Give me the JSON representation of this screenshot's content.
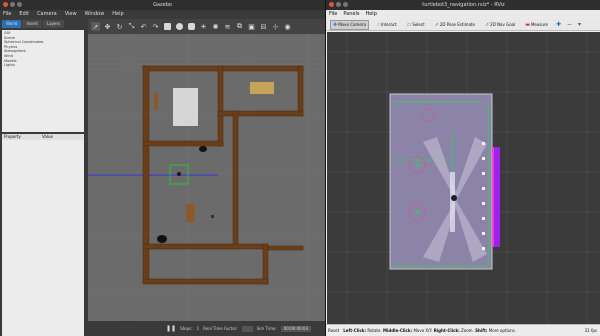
{
  "gazebo": {
    "title": "Gazebo",
    "menu": [
      "File",
      "Edit",
      "Camera",
      "View",
      "Window",
      "Help"
    ],
    "tabs": [
      "World",
      "Insert",
      "Layers"
    ],
    "world_tree": [
      "GUI",
      "Scene",
      "Spherical Coordinates",
      "Physics",
      "Atmosphere",
      "Wind",
      "Models",
      "Lights"
    ],
    "prop_headers": [
      "Property",
      "Value"
    ],
    "bottom": {
      "steps_label": "Steps:",
      "steps_value": "1",
      "rtf_label": "Real Time Factor:",
      "time_label": "Sim Time:",
      "time_value": "00:00:00:03"
    }
  },
  "rviz": {
    "title": "turtlebot3_navigation.rviz* - RViz",
    "menu": [
      "File",
      "Panels",
      "Help"
    ],
    "tools": [
      "Move Camera",
      "Interact",
      "Select",
      "2D Pose Estimate",
      "2D Nav Goal",
      "Measure"
    ],
    "status": {
      "reset": "Reset",
      "l": "Left-Click:",
      "l_text": "Rotate.",
      "m": "Middle-Click:",
      "m_text": "Move X/Y.",
      "r": "Right-Click:",
      "r_text": "Zoom.",
      "s": "Shift:",
      "s_text": "More options.",
      "fps": "31 fps"
    }
  },
  "colors": {
    "wall": "#6b3e18",
    "floor": "#6b6b6b",
    "map_free": "#8c83a8",
    "costmap": "#a020f0"
  }
}
